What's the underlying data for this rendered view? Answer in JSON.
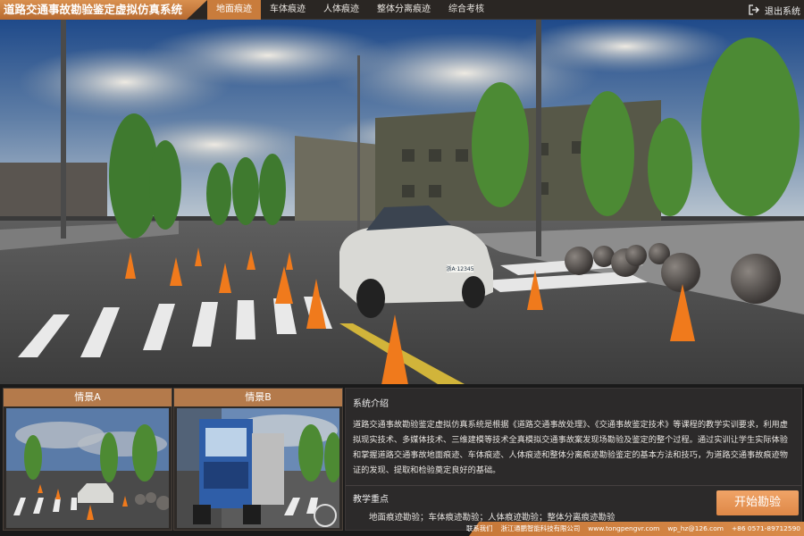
{
  "header": {
    "title": "道路交通事故勘验鉴定虚拟仿真系统",
    "tabs": [
      {
        "label": "地面痕迹",
        "active": true
      },
      {
        "label": "车体痕迹",
        "active": false
      },
      {
        "label": "人体痕迹",
        "active": false
      },
      {
        "label": "整体分离痕迹",
        "active": false
      },
      {
        "label": "综合考核",
        "active": false
      }
    ],
    "exit_label": "退出系统",
    "exit_icon": "exit-icon"
  },
  "hero": {
    "plate_text": "浙A·12345"
  },
  "scenes": [
    {
      "label": "情景A"
    },
    {
      "label": "情景B"
    }
  ],
  "info": {
    "intro_title": "系统介绍",
    "intro_text": "道路交通事故勘验鉴定虚拟仿真系统是根据《道路交通事故处理》、《交通事故鉴定技术》等课程的教学实训要求，利用虚拟现实技术、多媒体技术、三维建模等技术全真模拟交通事故案发现场勘验及鉴定的整个过程。通过实训让学生实际体验和掌握道路交通事故地面痕迹、车体痕迹、人体痕迹和整体分离痕迹勘验鉴定的基本方法和技巧，为道路交通事故痕迹物证的发现、提取和检验奠定良好的基础。",
    "focus_title": "教学重点",
    "focus_text": "地面痕迹勘验；车体痕迹勘验；人体痕迹勘验；整体分离痕迹勘验"
  },
  "start_button": "开始勘验",
  "footer": {
    "contact": "联系我们",
    "company": "浙江通鹏智能科技有限公司",
    "website": "www.tongpengvr.com",
    "email": "wp_hz@126.com",
    "phone": "+86 0571-89712590"
  },
  "colors": {
    "accent": "#c97c3c",
    "button": "#e8955a",
    "dark_bg": "#2a2623"
  }
}
